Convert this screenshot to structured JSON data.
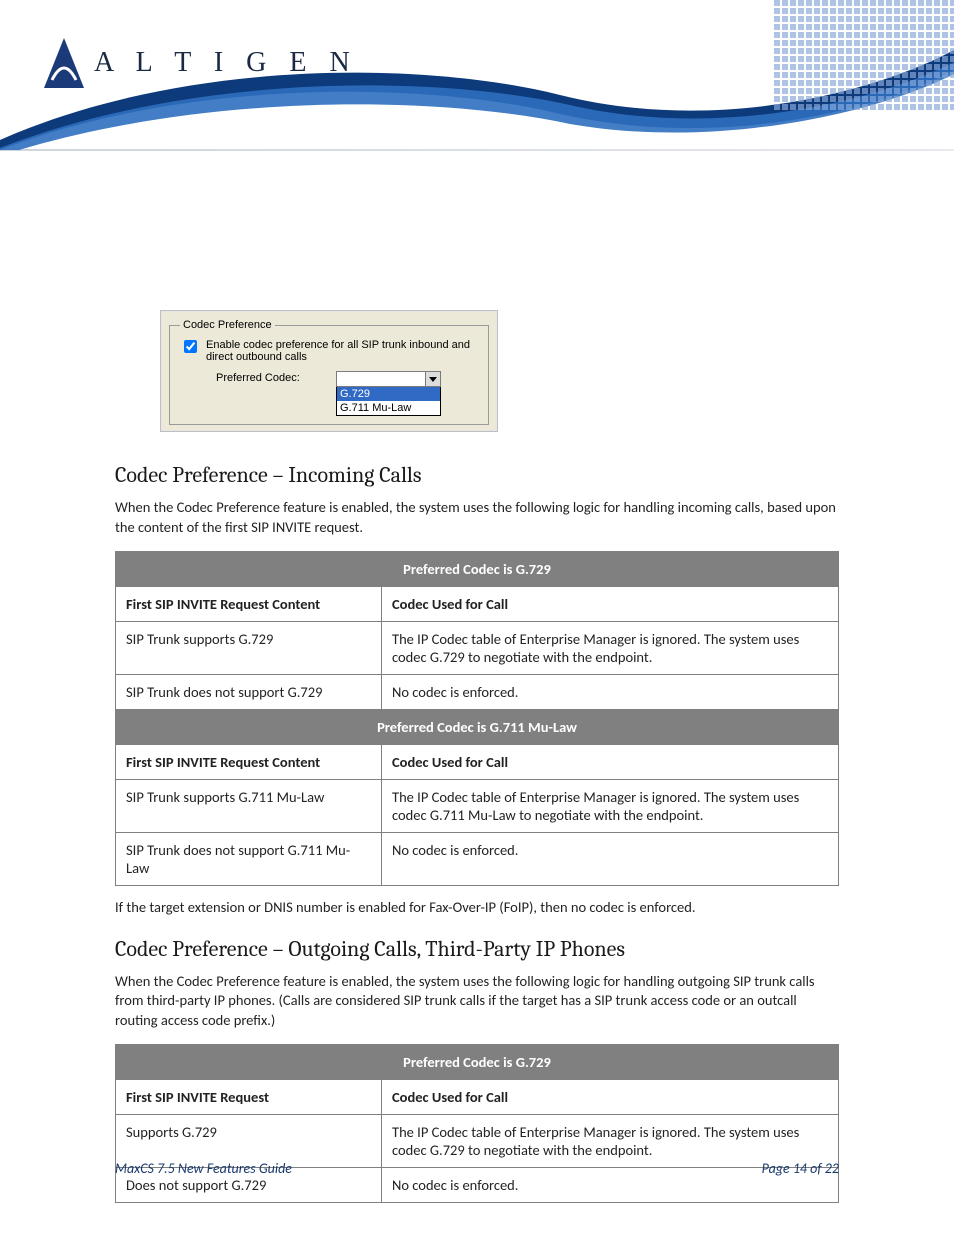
{
  "brand": {
    "name": "A L T I G E N"
  },
  "ui_box": {
    "legend": "Codec Preference",
    "checkbox_label": "Enable codec preference for all SIP trunk inbound and direct outbound calls",
    "dropdown_label": "Preferred Codec:",
    "options": [
      "G.729",
      "G.711 Mu-Law"
    ],
    "selected": "G.729"
  },
  "section1": {
    "heading": "Codec Preference – Incoming Calls",
    "intro": "When the Codec Preference feature is enabled, the system uses the following logic for handling incoming calls, based upon the content of the first SIP INVITE request.",
    "table": {
      "title1": "Preferred Codec is G.729",
      "h1": "First SIP INVITE Request Content",
      "h2": "Codec Used for Call",
      "r1c1": "SIP Trunk supports G.729",
      "r1c2": "The IP Codec table of Enterprise Manager is ignored. The system uses codec G.729 to negotiate with the endpoint.",
      "r2c1": "SIP Trunk does not support G.729",
      "r2c2": "No codec is enforced.",
      "title2": "Preferred Codec is G.711 Mu-Law",
      "h3": "First SIP INVITE Request Content",
      "h4": "Codec Used for Call",
      "r3c1": "SIP Trunk supports G.711 Mu-Law",
      "r3c2": "The IP Codec table of Enterprise Manager is ignored. The system uses codec G.711 Mu-Law to negotiate with the endpoint.",
      "r4c1": "SIP Trunk does not support G.711 Mu-Law",
      "r4c2": "No codec is enforced."
    },
    "note": "If the target extension or DNIS number is enabled for Fax-Over-IP (FoIP), then no codec is enforced."
  },
  "section2": {
    "heading": "Codec Preference – Outgoing Calls, Third-Party IP Phones",
    "intro": "When the Codec Preference feature is enabled, the system uses the following logic for handling outgoing SIP trunk calls from third-party IP phones.  (Calls are considered SIP trunk calls if the target has a SIP trunk access code or an outcall routing access code prefix.)",
    "table": {
      "title1": "Preferred Codec is G.729",
      "h1": "First SIP INVITE Request",
      "h2": "Codec Used for Call",
      "r1c1": "Supports G.729",
      "r1c2": "The IP Codec table of Enterprise Manager is ignored. The system uses codec G.729 to negotiate with the endpoint.",
      "r2c1": "Does not support G.729",
      "r2c2": "No codec is enforced."
    }
  },
  "footer": {
    "left": "MaxCS 7.5 New Features Guide",
    "right": "Page 14 of 22"
  }
}
